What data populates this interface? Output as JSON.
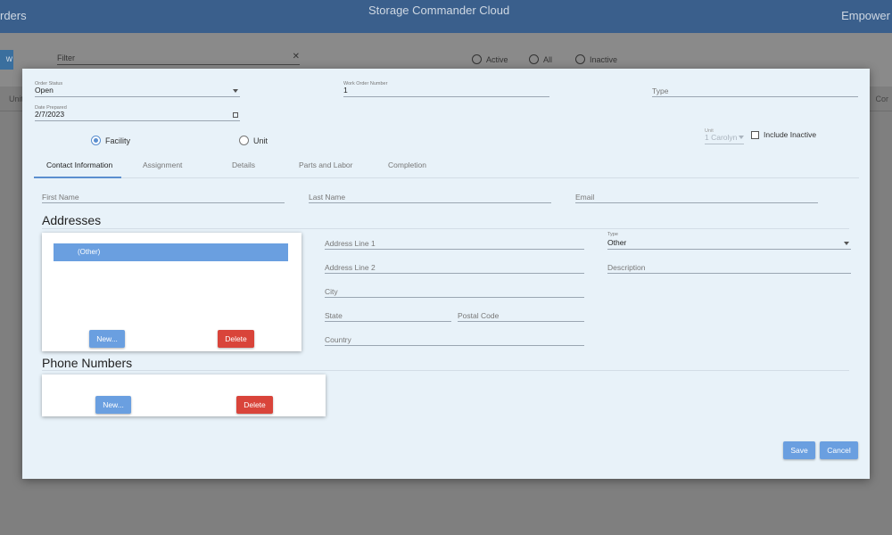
{
  "background": {
    "header_left": "rders",
    "header_center": "Storage Commander Cloud",
    "header_right": "Empower",
    "new_button_partial": "w",
    "filter_placeholder": "Filter",
    "filter_clear": "✕",
    "radios": [
      "Active",
      "All",
      "Inactive"
    ],
    "strip_left": "Unit",
    "strip_right": "Cor"
  },
  "form": {
    "order_status": {
      "label": "Order Status",
      "value": "Open"
    },
    "work_order_number": {
      "label": "Work Order Number",
      "value": "1"
    },
    "type_placeholder": "Type",
    "date_prepared": {
      "label": "Date Prepared",
      "value": "2/7/2023"
    },
    "scope_radios": [
      {
        "label": "Facility",
        "selected": true
      },
      {
        "label": "Unit",
        "selected": false
      }
    ],
    "unit_select": {
      "label": "Unit",
      "value": "1 Carolyn"
    },
    "include_inactive": "Include Inactive"
  },
  "tabs": [
    "Contact Information",
    "Assignment",
    "Details",
    "Parts and Labor",
    "Completion"
  ],
  "contact": {
    "first_name": "First Name",
    "last_name": "Last Name",
    "email": "Email"
  },
  "addresses": {
    "title": "Addresses",
    "selected_item": "(Other)",
    "new_label": "New...",
    "delete_label": "Delete",
    "address_line_1": "Address Line 1",
    "address_line_2": "Address Line 2",
    "city": "City",
    "state": "State",
    "postal_code": "Postal Code",
    "country": "Country",
    "type": {
      "label": "Type",
      "value": "Other"
    },
    "description": "Description"
  },
  "phones": {
    "title": "Phone Numbers",
    "new_label": "New...",
    "delete_label": "Delete"
  },
  "footer": {
    "save": "Save",
    "cancel": "Cancel"
  },
  "colors": {
    "accent": "#6a9fe0",
    "danger": "#d9443a",
    "modal_bg": "#e8f2f9",
    "header": "#3a5f8c"
  }
}
